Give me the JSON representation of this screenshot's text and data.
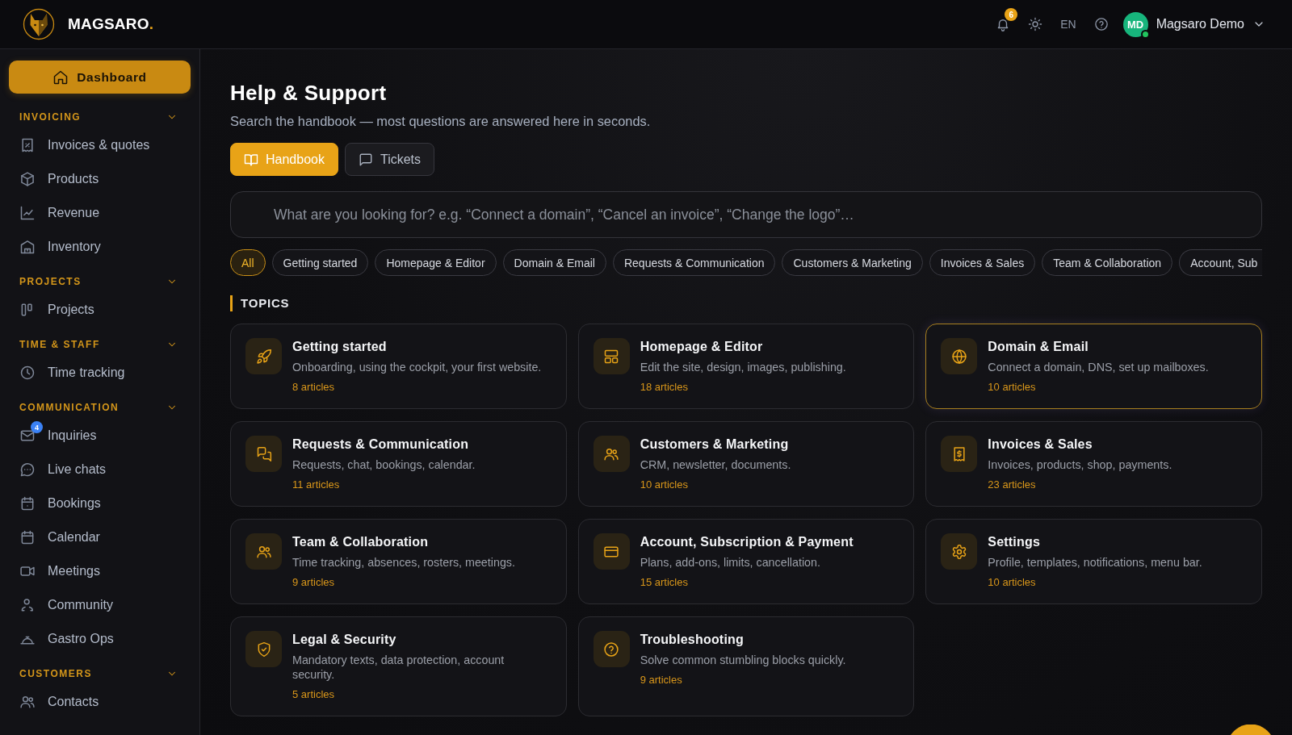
{
  "topbar": {
    "brand": {
      "name": "MAGSARO",
      "mark": "."
    },
    "notifications": {
      "count": "6"
    },
    "language": "EN",
    "user": {
      "initials": "MD",
      "name": "Magsaro Demo",
      "online": true
    }
  },
  "sidebar": {
    "primary": {
      "label": "Dashboard"
    },
    "sections": [
      {
        "title": "INVOICING",
        "expanded": true,
        "items": [
          {
            "label": "Invoices & quotes",
            "selected": false
          },
          {
            "label": "Products",
            "selected": false
          },
          {
            "label": "Revenue",
            "selected": false
          },
          {
            "label": "Inventory",
            "selected": false
          }
        ]
      },
      {
        "title": "PROJECTS",
        "expanded": true,
        "items": [
          {
            "label": "Projects",
            "selected": false
          }
        ]
      },
      {
        "title": "TIME & STAFF",
        "expanded": true,
        "items": [
          {
            "label": "Time tracking",
            "selected": false
          }
        ]
      },
      {
        "title": "COMMUNICATION",
        "expanded": true,
        "items": [
          {
            "label": "Inquiries",
            "selected": false,
            "badge": "4"
          },
          {
            "label": "Live chats",
            "selected": false
          },
          {
            "label": "Bookings",
            "selected": false
          },
          {
            "label": "Calendar",
            "selected": false
          },
          {
            "label": "Meetings",
            "selected": false
          },
          {
            "label": "Community",
            "selected": false
          },
          {
            "label": "Gastro Ops",
            "selected": false
          }
        ]
      },
      {
        "title": "CUSTOMERS",
        "expanded": true,
        "items": [
          {
            "label": "Contacts",
            "selected": false
          }
        ]
      }
    ]
  },
  "page": {
    "title": "Help & Support",
    "subtitle": "Search the handbook — most questions are answered here in seconds."
  },
  "tabs": [
    {
      "label": "Handbook",
      "selected": true
    },
    {
      "label": "Tickets",
      "selected": false
    }
  ],
  "search": {
    "placeholder": "What are you looking for? e.g. “Connect a domain”, “Cancel an invoice”, “Change the logo”…"
  },
  "filters": [
    {
      "label": "All",
      "selected": true
    },
    {
      "label": "Getting started",
      "selected": false
    },
    {
      "label": "Homepage & Editor",
      "selected": false
    },
    {
      "label": "Domain & Email",
      "selected": false
    },
    {
      "label": "Requests & Communication",
      "selected": false
    },
    {
      "label": "Customers & Marketing",
      "selected": false
    },
    {
      "label": "Invoices & Sales",
      "selected": false
    },
    {
      "label": "Team & Collaboration",
      "selected": false
    },
    {
      "label": "Account, Sub",
      "selected": false
    }
  ],
  "topics": {
    "heading": "TOPICS",
    "cards": [
      {
        "title": "Getting started",
        "description": "Onboarding, using the cockpit, your first website.",
        "articles": "8 articles",
        "highlighted": false
      },
      {
        "title": "Homepage & Editor",
        "description": "Edit the site, design, images, publishing.",
        "articles": "18 articles",
        "highlighted": false
      },
      {
        "title": "Domain & Email",
        "description": "Connect a domain, DNS, set up mailboxes.",
        "articles": "10 articles",
        "highlighted": true
      },
      {
        "title": "Requests & Communication",
        "description": "Requests, chat, bookings, calendar.",
        "articles": "11 articles",
        "highlighted": false
      },
      {
        "title": "Customers & Marketing",
        "description": "CRM, newsletter, documents.",
        "articles": "10 articles",
        "highlighted": false
      },
      {
        "title": "Invoices & Sales",
        "description": "Invoices, products, shop, payments.",
        "articles": "23 articles",
        "highlighted": false
      },
      {
        "title": "Team & Collaboration",
        "description": "Time tracking, absences, rosters, meetings.",
        "articles": "9 articles",
        "highlighted": false
      },
      {
        "title": "Account, Subscription & Payment",
        "description": "Plans, add-ons, limits, cancellation.",
        "articles": "15 articles",
        "highlighted": false
      },
      {
        "title": "Settings",
        "description": "Profile, templates, notifications, menu bar.",
        "articles": "10 articles",
        "highlighted": false
      },
      {
        "title": "Legal & Security",
        "description": "Mandatory texts, data protection, account security.",
        "articles": "5 articles",
        "highlighted": false
      },
      {
        "title": "Troubleshooting",
        "description": "Solve common stumbling blocks quickly.",
        "articles": "9 articles",
        "highlighted": false
      }
    ]
  }
}
